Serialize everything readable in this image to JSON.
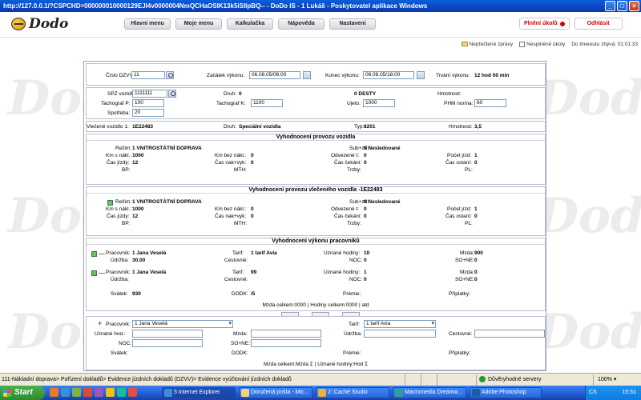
{
  "window": {
    "title": "http://127.0.0.1/?CSPCHD=000000010000129EJI4v0000004NmQCHaOSIK13k5iSIlpBQ-- - DoDo IS - 1 Lukáš - Poskytovatel aplikace Windows"
  },
  "app": {
    "logo_text": "Dodo"
  },
  "menu": [
    "Hlavní menu",
    "Moje menu",
    "Kalkulačka",
    "Nápověda",
    "Nastavení"
  ],
  "topright": {
    "tasks_label": "Plnění úkolů",
    "logout_label": "Odhlásit"
  },
  "status": {
    "unread": "Nepřečtené zprávy",
    "unfinished": "Nesplněné úkoly",
    "timeout_label": "Do timeoutu zbývá:",
    "timeout_value": "01:01:33"
  },
  "watermark": "Dodo",
  "header_row": {
    "cislo_label": "Číslo DZVV :",
    "cislo_value": "11",
    "zacatek_label": "Začátek výkonu:",
    "zacatek_value": "06.08.05/06:00",
    "konec_label": "Konec výkonu:",
    "konec_value": "06.08.05/18:00",
    "trvani_label": "Trvání výkonu:",
    "trvani_value": "12 hod 00 min"
  },
  "vehicle": {
    "spz_label": "SPZ vozidla:",
    "spz_value": "1111111",
    "druh_label": "Druh:",
    "druh_value": "0",
    "desty_value": "0 DESTY",
    "hmotnost_label": "Hmotnost:",
    "tachp_label": "Tachograf P:",
    "tachp_value": "100",
    "tachk_label": "Tachograf K:",
    "tachk_value": "1100",
    "ujeto_label": "Ujeto:",
    "ujeto_value": "1000",
    "phm_label": "PHM norma:",
    "phm_value": "60",
    "spotreba_label": "Spotřeba:",
    "spotreba_value": "20"
  },
  "trailer": {
    "label": "Vlečené vozidlo 1:",
    "value": "1E22483",
    "druh_label": "Druh:",
    "druh_value": "Speciální vozidla",
    "typ_label": "Typ:",
    "typ_value": "8201",
    "hmotnost_label": "Hmotnost:",
    "hmotnost_value": "3,5"
  },
  "eval_vehicle": {
    "title": "Vyhodnocení provozu vozidla",
    "rezim_label": "Režim:",
    "rezim_value": "1 VNITROSTÁTNÍ DOPRAVA",
    "subzd_label": "Sub+zd:",
    "subzd_value": "0 Nesledované",
    "kmnak_label": "Km s nákl.:",
    "kmnak_value": "1000",
    "kmbez_label": "Km bez nákl.:",
    "kmbez_value": "0",
    "odvez_label": "Odvezené t:",
    "odvez_value": "0",
    "pocet_label": "Počet jízd:",
    "pocet_value": "1",
    "casjizdy_label": "Čas jízdy:",
    "casjizdy_value": "12",
    "casnak_label": "Čas nak+vyk:",
    "casnak_value": "0",
    "cascek_label": "Čas čekání:",
    "cascek_value": "0",
    "casost_label": "Čas ostaní:",
    "casost_value": "0",
    "bp_label": "BP:",
    "mth_label": "MTH:",
    "trzby_label": "Trzby:",
    "pl_label": "PL:"
  },
  "eval_trailer": {
    "title": "Vyhodnocení provozu vlečeného vozidla -1E22483",
    "rezim_label": "Režim:",
    "rezim_value": "1 VNITROSTÁTNÍ DOPRAVA",
    "subzd_label": "Sub+zd:",
    "subzd_value": "0 Nesledované",
    "kmnak_label": "Km s nákl.:",
    "kmnak_value": "1000",
    "kmbez_label": "Km bez nákl.:",
    "kmbez_value": "0",
    "odvez_label": "Odvezené t:",
    "odvez_value": "0",
    "pocet_label": "Počet jízd:",
    "pocet_value": "1",
    "casjizdy_label": "Čas jízdy:",
    "casjizdy_value": "12",
    "casnak_label": "Čas nak+vyk:",
    "casnak_value": "0",
    "cascek_label": "Čas čekání:",
    "cascek_value": "0",
    "casost_label": "Čas ostaní:",
    "casost_value": "0",
    "bp_label": "BP:",
    "mth_label": "MTH:",
    "trzby_label": "Trzby:",
    "pl_label": "PL:"
  },
  "workers": {
    "title": "Vyhodnocení výkonu pracovníků",
    "rows": [
      {
        "pracovnik_label": "Pracovník:",
        "pracovnik_value": "1 Jana Veselá",
        "tarif_label": "Tarif:",
        "tarif_value": "1 tarif Avia",
        "uzhod_label": "Uznané hodiny:",
        "uzhod_value": "10",
        "mzda_label": "Mzda:",
        "mzda_value": "900",
        "udrzba_label": "Údržba:",
        "udrzba_value": "30.00",
        "cestovne_label": "Cestovné:",
        "noc_label": "NOC:",
        "noc_value": "0",
        "sone_label": "SO+NE:",
        "sone_value": "0"
      },
      {
        "pracovnik_label": "Pracovník:",
        "pracovnik_value": "1 Jana Veselá",
        "tarif_label": "Tarif:",
        "tarif_value": "99",
        "uzhod_label": "Uznané hodiny:",
        "uzhod_value": "1",
        "mzda_label": "Mzda:",
        "mzda_value": "0",
        "udrzba_label": "Údržba:",
        "udrzba_value": "",
        "cestovne_label": "Cestovné:",
        "noc_label": "NOC:",
        "noc_value": "0",
        "sone_label": "SO+NE:",
        "sone_value": "0"
      }
    ],
    "svatek_label": "Svátek:",
    "svatek_value": "930",
    "dodk_label": "DODK:",
    "dodk_value": "/5",
    "premie_label": "Prémie:",
    "priplatky_label": "Příplatky:",
    "summary": "Mzda celkem:0000  |  Hodiny celkem:0000  |  atd"
  },
  "form": {
    "pracovnik_label": "Pracovník:",
    "pracovnik_value": "1 Jana Veselá",
    "tarif_label": "Tarif:",
    "tarif_value": "1 tarif Avia",
    "uzhod_label": "Uznané hod.:",
    "mzda_label": "Mzda:",
    "udrzba_label": "Údržba:",
    "cestovne_label": "Cestovné:",
    "noc_label": "NOC:",
    "sone_label": "SO+NE:",
    "svatek_label": "Svátek:",
    "dodk_label": "DODK:",
    "premie_label": "Prémie:",
    "priplatky_label": "Příplatky:",
    "summary": "Mzda celkem:Mzda Σ  |  Uznané hodiny:Hod Σ"
  },
  "statusbar": {
    "path": "111-Nákladní doprava> Pořízení dokladů> Evidence jízdních dokladů (DZVV)> Evidence vyúčtování jízdních dokladů",
    "zone": "Důvěryhodné servery",
    "zoom": "100%"
  },
  "taskbar": {
    "start": "Start",
    "tasks": [
      "5 Internet Explorer",
      "Doručená pošta - Mic...",
      "2: Caché Studio",
      "Macromedia Dreamw...",
      "Adobe Photoshop"
    ],
    "lang": "CS",
    "time": "15:51"
  }
}
